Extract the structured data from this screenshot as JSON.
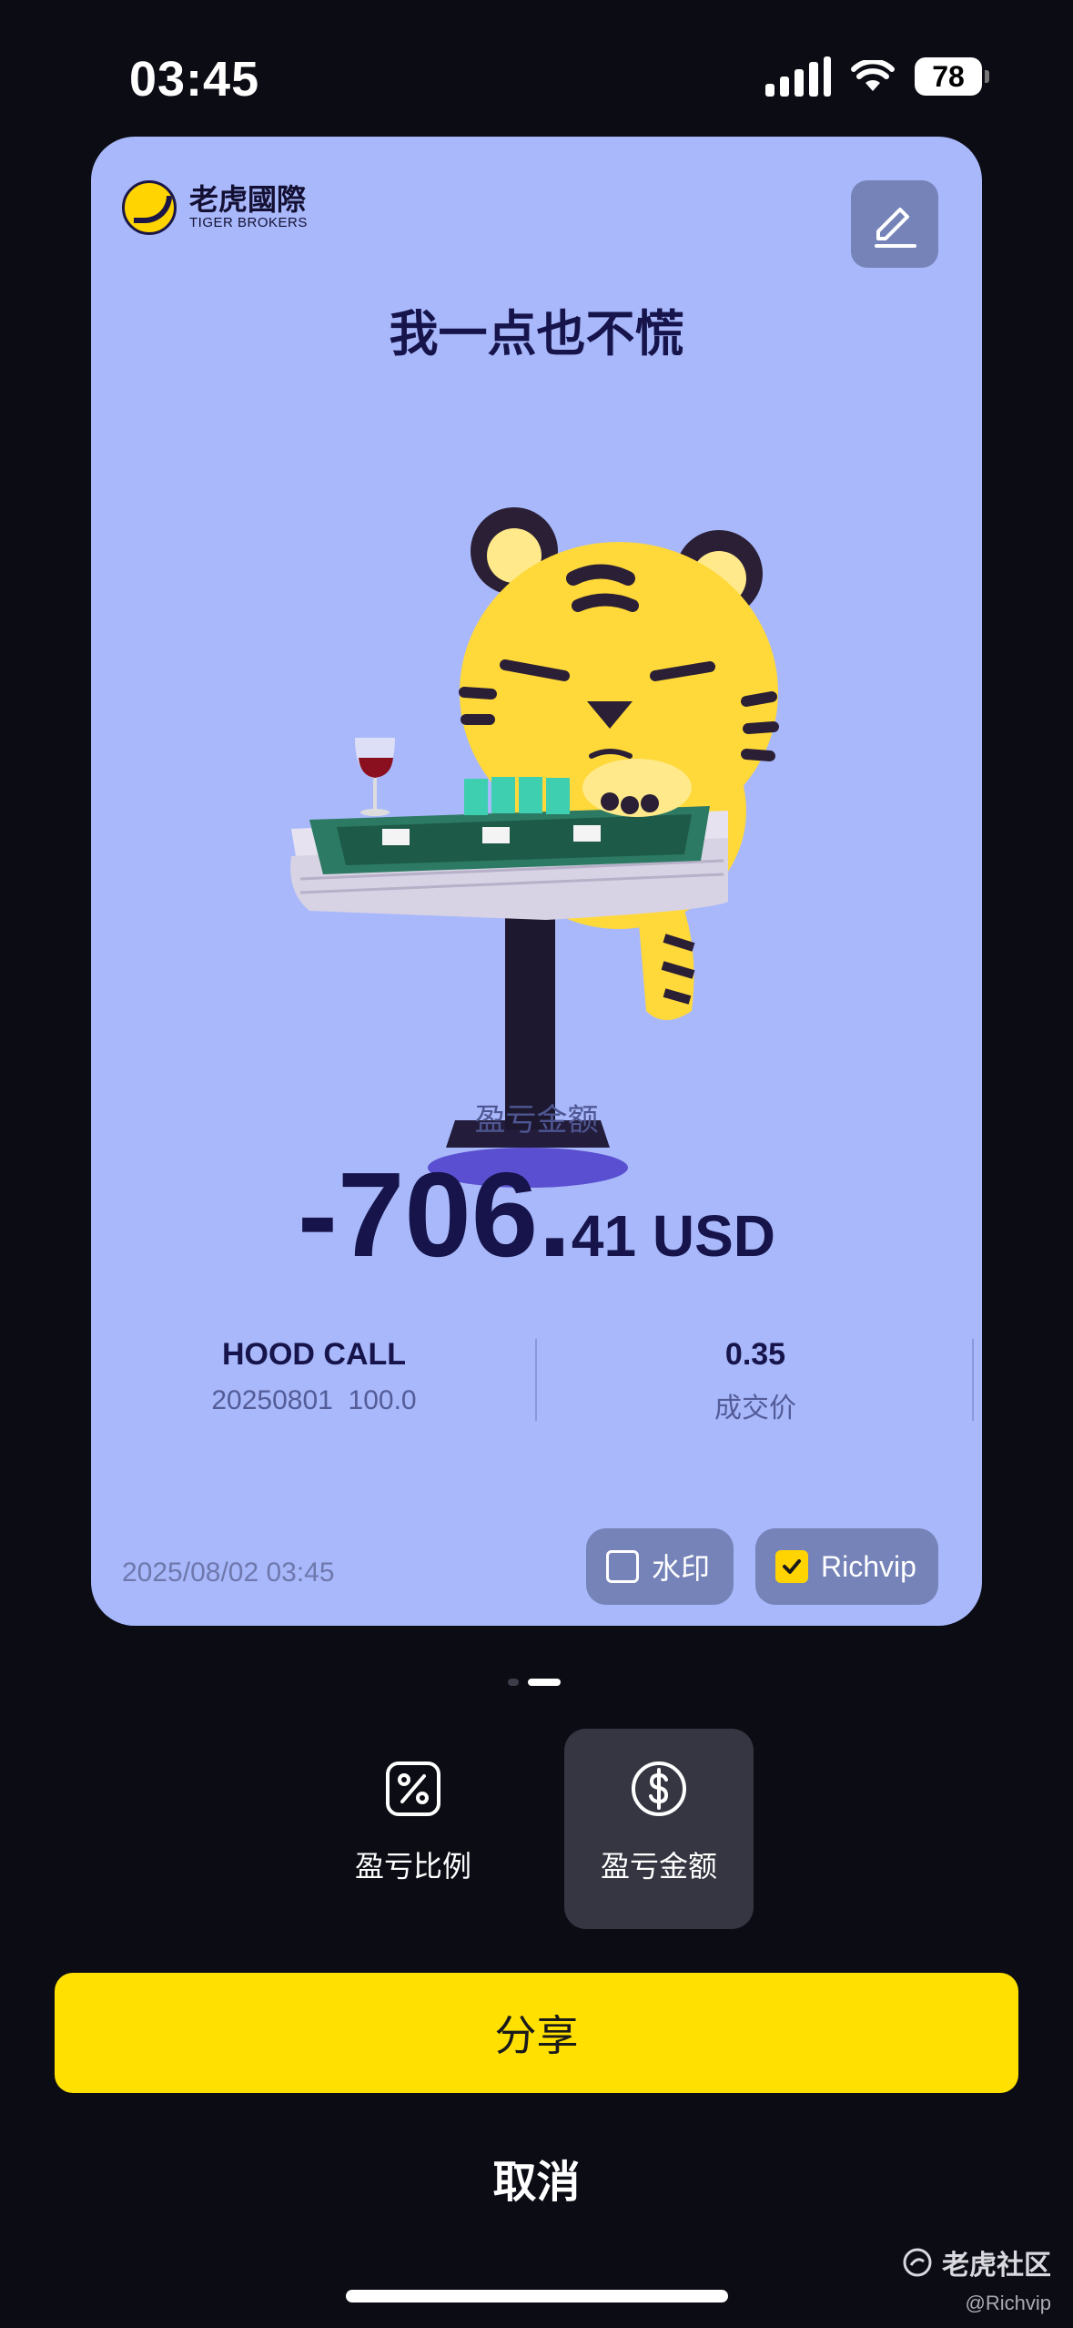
{
  "status_bar": {
    "time": "03:45",
    "battery": "78",
    "icons": [
      "signal-icon",
      "wifi-icon",
      "battery-icon"
    ]
  },
  "card": {
    "brand": {
      "name_cn": "老虎國際",
      "name_en": "TIGER BROKERS"
    },
    "title": "我一点也不慌",
    "pnl_label": "盈亏金额",
    "pnl_integer": "-706.",
    "pnl_decimal": "41 USD",
    "stat_left": {
      "main": "HOOD CALL",
      "sub": "20250801  100.0"
    },
    "stat_right": {
      "main": "0.35",
      "sub": "成交价"
    },
    "date": "2025/08/02 03:45",
    "watermark_label": "水印",
    "watermark_checked": false,
    "richvip_label": "Richvip",
    "richvip_checked": true
  },
  "pager": {
    "pages": 2,
    "current": 2
  },
  "modes": [
    {
      "label": "盈亏比例",
      "icon": "percent-icon",
      "selected": false
    },
    {
      "label": "盈亏金额",
      "icon": "dollar-icon",
      "selected": true
    }
  ],
  "share_label": "分享",
  "cancel_label": "取消",
  "watermark_overlay": {
    "text": "老虎社区",
    "handle": "@Richvip"
  },
  "colors": {
    "card_bg": "#a8b8fb",
    "accent_yellow": "#ffe000",
    "page_bg": "#0b0c14",
    "title_navy": "#16144a"
  }
}
